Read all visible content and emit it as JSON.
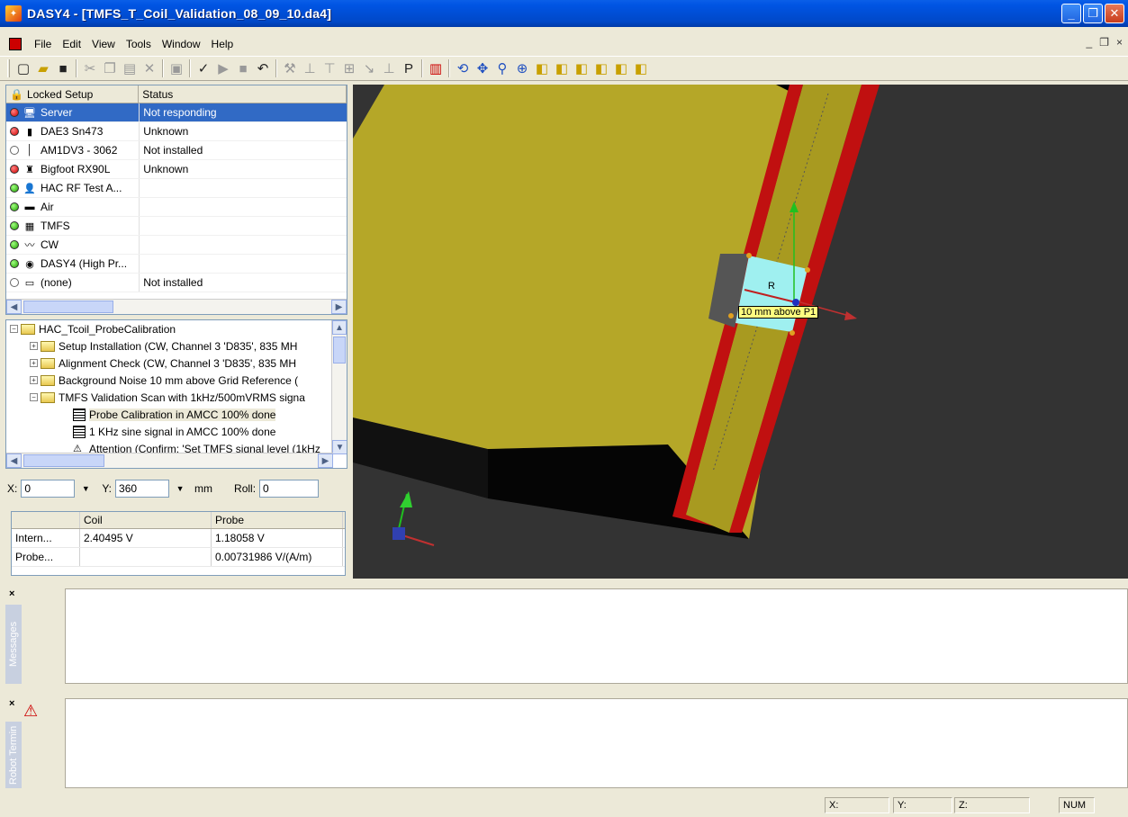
{
  "window": {
    "title": "DASY4 - [TMFS_T_Coil_Validation_08_09_10.da4]",
    "minimize": "_",
    "maximize": "❐",
    "close": "✕"
  },
  "menu": {
    "items": [
      "File",
      "Edit",
      "View",
      "Tools",
      "Window",
      "Help"
    ],
    "mdi_min": "_",
    "mdi_restore": "❐",
    "mdi_close": "×"
  },
  "setup": {
    "header_name": "Locked Setup",
    "header_status": "Status",
    "rows": [
      {
        "name": "Server",
        "status": "Not responding",
        "dot": "red",
        "icon": "server-icon",
        "selected": true
      },
      {
        "name": "DAE3 Sn473",
        "status": "Unknown",
        "dot": "red",
        "icon": "dae-icon"
      },
      {
        "name": "AM1DV3 - 3062",
        "status": "Not installed",
        "dot": "empty",
        "icon": "probe-icon"
      },
      {
        "name": "Bigfoot RX90L",
        "status": "Unknown",
        "dot": "red",
        "icon": "robot-icon"
      },
      {
        "name": "HAC RF Test A...",
        "status": "",
        "dot": "green",
        "icon": "phantom-icon"
      },
      {
        "name": "Air",
        "status": "",
        "dot": "green",
        "icon": "medium-icon"
      },
      {
        "name": "TMFS",
        "status": "",
        "dot": "green",
        "icon": "device-icon"
      },
      {
        "name": "CW",
        "status": "",
        "dot": "green",
        "icon": "signal-icon"
      },
      {
        "name": "DASY4 (High Pr...",
        "status": "",
        "dot": "green",
        "icon": "globe-icon"
      },
      {
        "name": "(none)",
        "status": "Not installed",
        "dot": "empty",
        "icon": "none-icon"
      }
    ]
  },
  "tree": {
    "root": "HAC_Tcoil_ProbeCalibration",
    "items": [
      {
        "label": "Setup Installation (CW, Channel 3 'D835', 835 MH",
        "type": "folder",
        "exp": "+"
      },
      {
        "label": "Alignment Check (CW, Channel 3 'D835', 835 MH",
        "type": "folder",
        "exp": "+"
      },
      {
        "label": "Background Noise 10 mm above Grid Reference (",
        "type": "folder",
        "exp": "+"
      },
      {
        "label": "TMFS Validation Scan with 1kHz/500mVRMS signa",
        "type": "folder",
        "exp": "-"
      },
      {
        "label": "Probe Calibration in AMCC 100% done",
        "type": "doc",
        "highlight": true
      },
      {
        "label": "1 KHz sine signal in AMCC 100% done",
        "type": "doc"
      },
      {
        "label": "Attention (Confirm: 'Set TMFS signal level (1kHz",
        "type": "attn"
      }
    ]
  },
  "coords": {
    "x_label": "X:",
    "x_value": "0",
    "y_label": "Y:",
    "y_value": "360",
    "unit": "mm",
    "roll_label": "Roll:",
    "roll_value": "0"
  },
  "values": {
    "headers": [
      "",
      "Coil",
      "Probe"
    ],
    "rows": [
      [
        "Intern...",
        "2.40495 V",
        "1.18058 V"
      ],
      [
        "Probe...",
        "",
        "0.00731986 V/(A/m)"
      ]
    ]
  },
  "viewport": {
    "marker_label": "10 mm above P1",
    "axis_label": "R",
    "colors": {
      "background": "#333333",
      "plate": "#b5a728",
      "frame": "#c01010",
      "probe_box": "#9ff0f0"
    }
  },
  "panes": {
    "messages": "Messages",
    "terminal": "Robot Termin"
  },
  "status": {
    "x": "X:",
    "y": "Y:",
    "z": "Z:",
    "num": "NUM"
  }
}
